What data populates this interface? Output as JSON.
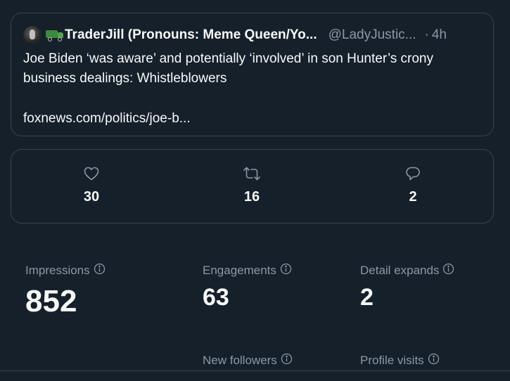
{
  "tweet": {
    "display_name": "TraderJill (Pronouns: Meme Queen/Yo...",
    "handle": "@LadyJustic...",
    "dot": "·",
    "time": "4h",
    "text": "Joe Biden ‘was aware’ and potentially ‘involved’ in son Hunter’s crony business dealings: Whistleblowers",
    "link": "foxnews.com/politics/joe-b..."
  },
  "engagement": {
    "likes": "30",
    "retweets": "16",
    "replies": "2"
  },
  "metrics": {
    "impressions": {
      "label": "Impressions",
      "value": "852"
    },
    "engagements": {
      "label": "Engagements",
      "value": "63"
    },
    "detail_expands": {
      "label": "Detail expands",
      "value": "2"
    },
    "new_followers": {
      "label": "New followers"
    },
    "profile_visits": {
      "label": "Profile visits"
    }
  },
  "colors": {
    "background": "#15202b",
    "border": "#38444d",
    "primary_text": "#f7f9f9",
    "secondary_text": "#8b98a5"
  },
  "icons": {
    "likes": "heart-icon",
    "retweets": "retweet-icon",
    "replies": "reply-icon",
    "info": "info-icon"
  }
}
